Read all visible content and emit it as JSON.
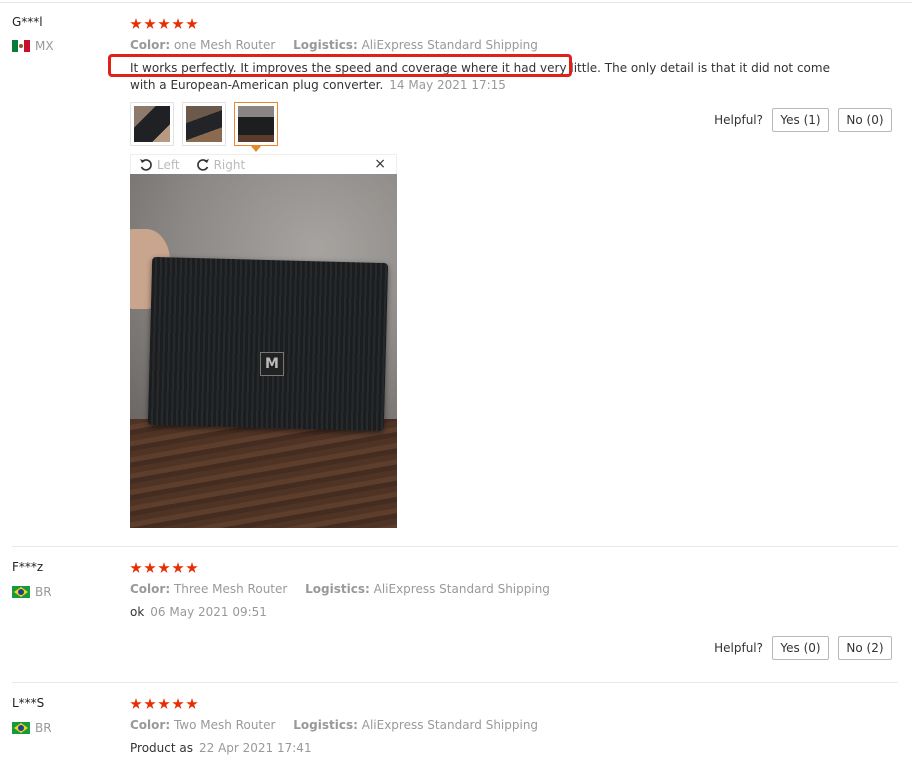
{
  "reviews": [
    {
      "user": "G***l",
      "country": "MX",
      "rating": 5,
      "color_label": "Color:",
      "color": "one Mesh Router",
      "logistics_label": "Logistics:",
      "logistics": "AliExpress Standard Shipping",
      "text_line1": "It works perfectly. It improves the speed and coverage where it had very little. The only detail is that it did not come",
      "text_line2": "with a European-American plug converter.",
      "date": "14 May 2021 17:15",
      "helpful_label": "Helpful?",
      "yes": "Yes (1)",
      "no": "No (0)",
      "viewer": {
        "left": "Left",
        "right": "Right",
        "close": "×"
      }
    },
    {
      "user": "F***z",
      "country": "BR",
      "rating": 5,
      "color_label": "Color:",
      "color": "Three Mesh Router",
      "logistics_label": "Logistics:",
      "logistics": "AliExpress Standard Shipping",
      "text": "ok",
      "date": "06 May 2021 09:51",
      "helpful_label": "Helpful?",
      "yes": "Yes (0)",
      "no": "No (2)"
    },
    {
      "user": "L***S",
      "country": "BR",
      "rating": 5,
      "color_label": "Color:",
      "color": "Two Mesh Router",
      "logistics_label": "Logistics:",
      "logistics": "AliExpress Standard Shipping",
      "text": "Product as",
      "date": "22 Apr 2021 17:41"
    }
  ],
  "colors": {
    "star": "#e62e04",
    "highlight": "#e0201b",
    "selected_thumb": "#e7892b"
  },
  "icons": [
    "rotate-left-icon",
    "rotate-right-icon",
    "close-icon",
    "star-icon",
    "flag-mx-icon",
    "flag-br-icon"
  ]
}
